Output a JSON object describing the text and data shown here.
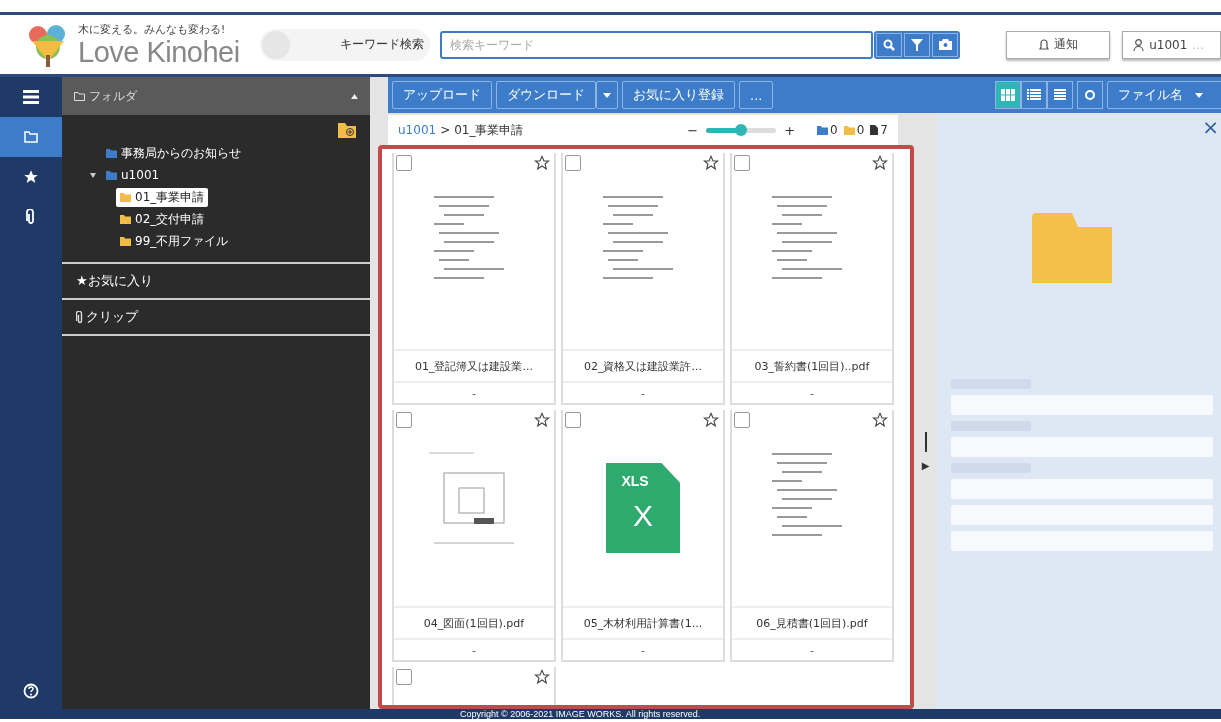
{
  "header": {
    "tagline": "木に変える。みんなも変わる!",
    "logo_text": "Love Kinohei",
    "toggle": {
      "label": "キーワード検索",
      "on": false
    },
    "search": {
      "placeholder": "検索キーワード"
    },
    "notify_button": "通知",
    "user_button": "u1001",
    "user_more": "..."
  },
  "rail": [
    {
      "kind": "menu",
      "selected": false
    },
    {
      "kind": "folder",
      "selected": true
    },
    {
      "kind": "star",
      "selected": false
    },
    {
      "kind": "clip",
      "selected": false
    }
  ],
  "folder_panel": {
    "title": "フォルダ",
    "tree": [
      {
        "label": "事務局からのお知らせ",
        "kind": "shared",
        "selected": false
      },
      {
        "label": "u1001",
        "kind": "shared",
        "selected": false,
        "expanded": true,
        "children": [
          {
            "label": "01_事業申請",
            "kind": "folder",
            "selected": true
          },
          {
            "label": "02_交付申請",
            "kind": "folder",
            "selected": false
          },
          {
            "label": "99_不用ファイル",
            "kind": "folder",
            "selected": false
          }
        ]
      }
    ],
    "sections": [
      {
        "kind": "favorites",
        "label": "★お気に入り"
      },
      {
        "kind": "clip",
        "label": "クリップ"
      }
    ]
  },
  "toolbar": {
    "upload": "アップロード",
    "download": "ダウンロード",
    "favorite": "お気に入り登録",
    "more": "...",
    "view_modes": [
      {
        "kind": "grid",
        "selected": true
      },
      {
        "kind": "list",
        "selected": false
      },
      {
        "kind": "detail",
        "selected": false
      }
    ],
    "sort": "ファイル名"
  },
  "breadcrumb": {
    "items": [
      "u1001",
      "01_事業申請"
    ],
    "separator": ">"
  },
  "zoom": {
    "minus": "−",
    "plus": "+",
    "level": 0.5
  },
  "counts": [
    {
      "kind": "shared",
      "value": "0"
    },
    {
      "kind": "folder",
      "value": "0"
    },
    {
      "kind": "file",
      "value": "7"
    }
  ],
  "files": [
    {
      "kind": "pdf",
      "name": "01_登記簿又は建設業...",
      "sub": "-",
      "checked": false,
      "starred": false
    },
    {
      "kind": "pdf",
      "name": "02_資格又は建設業許...",
      "sub": "-",
      "checked": false,
      "starred": false
    },
    {
      "kind": "pdf",
      "name": "03_誓約書(1回目)..pdf",
      "sub": "-",
      "checked": false,
      "starred": false
    },
    {
      "kind": "drawing",
      "name": "04_図面(1回目).pdf",
      "sub": "-",
      "checked": false,
      "starred": false
    },
    {
      "kind": "xls",
      "name": "05_木材利用計算書(1...",
      "sub": "-",
      "checked": false,
      "starred": false,
      "badge": "XLS",
      "glyph": "X"
    },
    {
      "kind": "pdf",
      "name": "06_見積書(1回目).pdf",
      "sub": "-",
      "checked": false,
      "starred": false
    },
    {
      "kind": "empty",
      "checked": false,
      "starred": false
    }
  ],
  "splitter": {
    "arrow": "▶"
  },
  "detail": {
    "close": "×"
  },
  "footer": "Copyright © 2006-2021 IMAGE WORKS. All rights reserved."
}
